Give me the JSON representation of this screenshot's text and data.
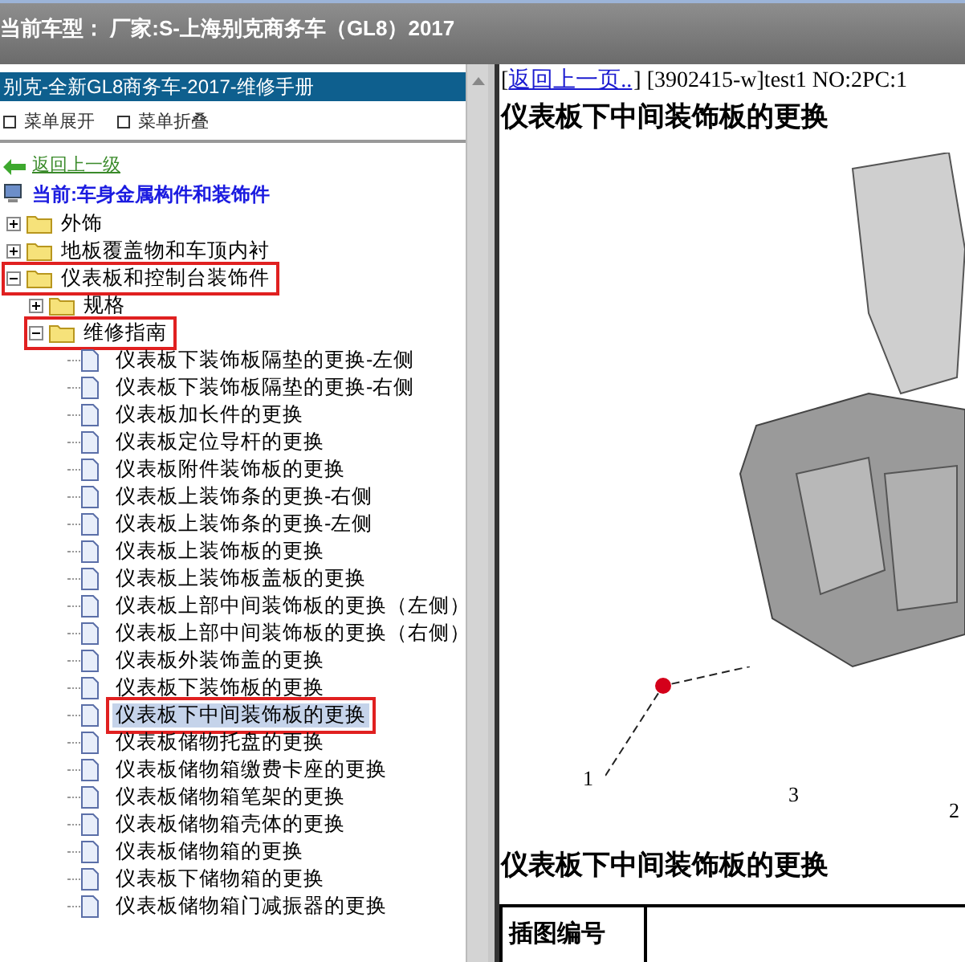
{
  "header": {
    "title": "当前车型： 厂家:S-上海别克商务车（GL8）2017"
  },
  "sidebar": {
    "title": "别克-全新GL8商务车-2017-维修手册",
    "toolbar": [
      "菜单展开",
      "菜单折叠"
    ],
    "back_link": "返回上一级",
    "current": "当前:车身金属构件和装饰件",
    "tree": [
      {
        "label": "外饰",
        "kind": "folder",
        "expanded": false,
        "annotated": false
      },
      {
        "label": "地板覆盖物和车顶内衬",
        "kind": "folder",
        "expanded": false,
        "annotated": false
      },
      {
        "label": "仪表板和控制台装饰件",
        "kind": "folder",
        "expanded": true,
        "annotated": true,
        "children": [
          {
            "label": "规格",
            "kind": "folder",
            "expanded": false,
            "annotated": false
          },
          {
            "label": "维修指南",
            "kind": "folder",
            "expanded": true,
            "annotated": true,
            "children": [
              {
                "label": "仪表板下装饰板隔垫的更换-左侧",
                "kind": "doc",
                "selected": false,
                "annotated": false
              },
              {
                "label": "仪表板下装饰板隔垫的更换-右侧",
                "kind": "doc",
                "selected": false,
                "annotated": false
              },
              {
                "label": "仪表板加长件的更换",
                "kind": "doc",
                "selected": false,
                "annotated": false
              },
              {
                "label": "仪表板定位导杆的更换",
                "kind": "doc",
                "selected": false,
                "annotated": false
              },
              {
                "label": "仪表板附件装饰板的更换",
                "kind": "doc",
                "selected": false,
                "annotated": false
              },
              {
                "label": "仪表板上装饰条的更换-右侧",
                "kind": "doc",
                "selected": false,
                "annotated": false
              },
              {
                "label": "仪表板上装饰条的更换-左侧",
                "kind": "doc",
                "selected": false,
                "annotated": false
              },
              {
                "label": "仪表板上装饰板的更换",
                "kind": "doc",
                "selected": false,
                "annotated": false
              },
              {
                "label": "仪表板上装饰板盖板的更换",
                "kind": "doc",
                "selected": false,
                "annotated": false
              },
              {
                "label": "仪表板上部中间装饰板的更换（左侧）",
                "kind": "doc",
                "selected": false,
                "annotated": false
              },
              {
                "label": "仪表板上部中间装饰板的更换（右侧）",
                "kind": "doc",
                "selected": false,
                "annotated": false
              },
              {
                "label": "仪表板外装饰盖的更换",
                "kind": "doc",
                "selected": false,
                "annotated": false
              },
              {
                "label": "仪表板下装饰板的更换",
                "kind": "doc",
                "selected": false,
                "annotated": false
              },
              {
                "label": "仪表板下中间装饰板的更换",
                "kind": "doc",
                "selected": true,
                "annotated": true
              },
              {
                "label": "仪表板储物托盘的更换",
                "kind": "doc",
                "selected": false,
                "annotated": false
              },
              {
                "label": "仪表板储物箱缴费卡座的更换",
                "kind": "doc",
                "selected": false,
                "annotated": false
              },
              {
                "label": "仪表板储物箱笔架的更换",
                "kind": "doc",
                "selected": false,
                "annotated": false
              },
              {
                "label": "仪表板储物箱壳体的更换",
                "kind": "doc",
                "selected": false,
                "annotated": false
              },
              {
                "label": "仪表板储物箱的更换",
                "kind": "doc",
                "selected": false,
                "annotated": false
              },
              {
                "label": "仪表板下储物箱的更换",
                "kind": "doc",
                "selected": false,
                "annotated": false
              },
              {
                "label": "仪表板储物箱门减振器的更换",
                "kind": "doc",
                "selected": false,
                "annotated": false
              }
            ]
          }
        ]
      }
    ]
  },
  "content": {
    "bracket": "[",
    "back_link": "返回上一页..",
    "info": "] [3902415-w]test1 NO:2PC:1",
    "title": "仪表板下中间装饰板的更换",
    "figure": {
      "callouts": [
        "1",
        "3",
        "2"
      ]
    },
    "section_title": "仪表板下中间装饰板的更换",
    "table": {
      "columns": [
        "插图编号"
      ]
    }
  }
}
